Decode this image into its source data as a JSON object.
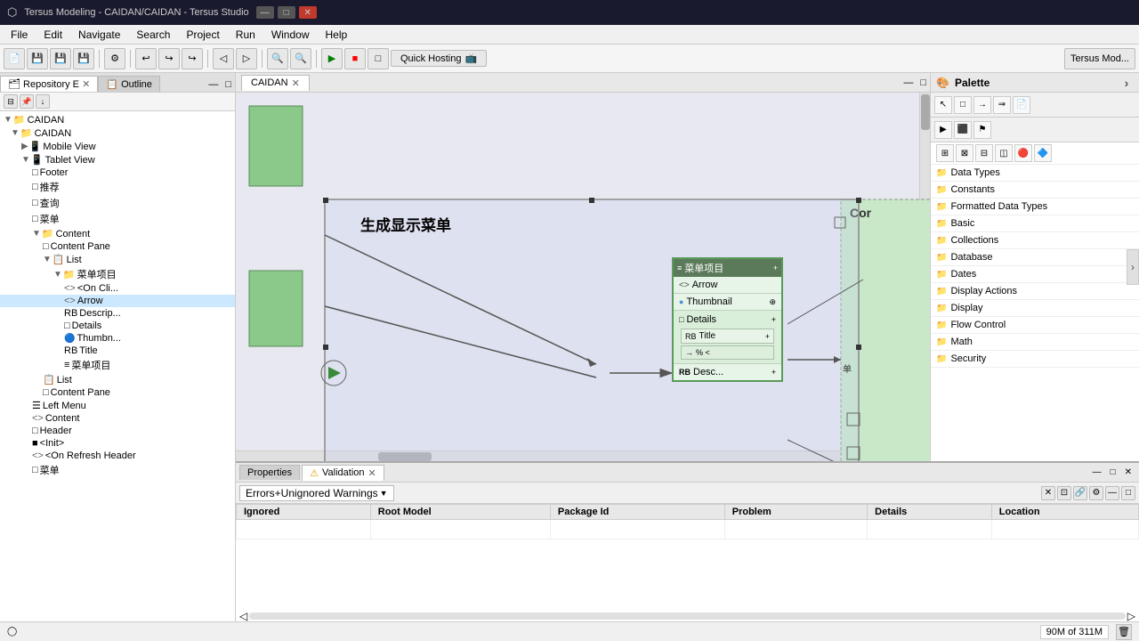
{
  "titlebar": {
    "title": "Tersus Modeling - CAIDAN/CAIDAN - Tersus Studio",
    "icon": "⬡"
  },
  "menubar": {
    "items": [
      "File",
      "Edit",
      "Navigate",
      "Search",
      "Project",
      "Run",
      "Window",
      "Help"
    ]
  },
  "toolbar": {
    "quick_hosting": "Quick Hosting",
    "tersus_mod": "Tersus Mod..."
  },
  "left_panel": {
    "title": "Repository E",
    "outline": "Outline",
    "tree": {
      "root": "CAIDAN",
      "items": [
        {
          "label": "CAIDAN",
          "level": 1,
          "type": "folder",
          "expanded": true
        },
        {
          "label": "Mobile View",
          "level": 2,
          "type": "folder"
        },
        {
          "label": "Tablet View",
          "level": 2,
          "type": "folder",
          "expanded": true
        },
        {
          "label": "Footer",
          "level": 3,
          "type": "item"
        },
        {
          "label": "推荐",
          "level": 3,
          "type": "item"
        },
        {
          "label": "查询",
          "level": 3,
          "type": "item"
        },
        {
          "label": "菜单",
          "level": 3,
          "type": "item"
        },
        {
          "label": "Content",
          "level": 3,
          "type": "folder",
          "expanded": true
        },
        {
          "label": "Content Pane",
          "level": 4,
          "type": "item"
        },
        {
          "label": "List",
          "level": 4,
          "type": "item"
        },
        {
          "label": "菜单项目",
          "level": 5,
          "type": "folder",
          "expanded": true
        },
        {
          "label": "<On Cli...",
          "level": 6,
          "type": "item"
        },
        {
          "label": "Arrow",
          "level": 6,
          "type": "item"
        },
        {
          "label": "Descrip...",
          "level": 6,
          "type": "item"
        },
        {
          "label": "Details",
          "level": 6,
          "type": "item"
        },
        {
          "label": "Thumbn...",
          "level": 6,
          "type": "item"
        },
        {
          "label": "Title",
          "level": 6,
          "type": "item"
        },
        {
          "label": "菜单项目",
          "level": 6,
          "type": "item"
        },
        {
          "label": "List",
          "level": 4,
          "type": "item"
        },
        {
          "label": "Content Pane",
          "level": 4,
          "type": "item"
        },
        {
          "label": "Left Menu",
          "level": 3,
          "type": "item"
        },
        {
          "label": "Content",
          "level": 3,
          "type": "item"
        },
        {
          "label": "Header",
          "level": 3,
          "type": "item"
        },
        {
          "label": "<Init>",
          "level": 3,
          "type": "item"
        },
        {
          "label": "<On Refresh Header",
          "level": 3,
          "type": "item"
        },
        {
          "label": "菜单",
          "level": 3,
          "type": "item"
        }
      ]
    }
  },
  "editor": {
    "active_tab": "CAIDAN",
    "tabs": [
      {
        "label": "CAIDAN",
        "active": true
      }
    ]
  },
  "diagram": {
    "outer_title": "生成显示菜单",
    "menu_box_title": "菜单项目",
    "items": [
      {
        "label": "Arrow",
        "icon": "arrow"
      },
      {
        "label": "Thumbnail",
        "icon": "thumb"
      },
      {
        "label": "Details",
        "icon": "details",
        "expanded": true,
        "children": [
          {
            "label": "Title",
            "icon": "text"
          },
          {
            "label": "% <",
            "icon": "code"
          }
        ]
      },
      {
        "label": "Desc...",
        "icon": "text"
      }
    ]
  },
  "palette": {
    "title": "Palette",
    "categories": [
      {
        "label": "Data Types"
      },
      {
        "label": "Constants"
      },
      {
        "label": "Formatted Data Types"
      },
      {
        "label": "Basic"
      },
      {
        "label": "Collections"
      },
      {
        "label": "Database"
      },
      {
        "label": "Dates"
      },
      {
        "label": "Display Actions"
      },
      {
        "label": "Display"
      },
      {
        "label": "Flow Control"
      },
      {
        "label": "Math"
      },
      {
        "label": "Security"
      }
    ]
  },
  "bottom_panel": {
    "tabs": [
      {
        "label": "Properties",
        "active": false
      },
      {
        "label": "Validation",
        "active": true
      }
    ],
    "filter": "Errors+Unignored Warnings",
    "columns": [
      "Ignored",
      "Root Model",
      "Package Id",
      "Problem",
      "Details",
      "Location"
    ]
  },
  "statusbar": {
    "memory": "90M of 311M"
  },
  "cor_label": "Cor"
}
